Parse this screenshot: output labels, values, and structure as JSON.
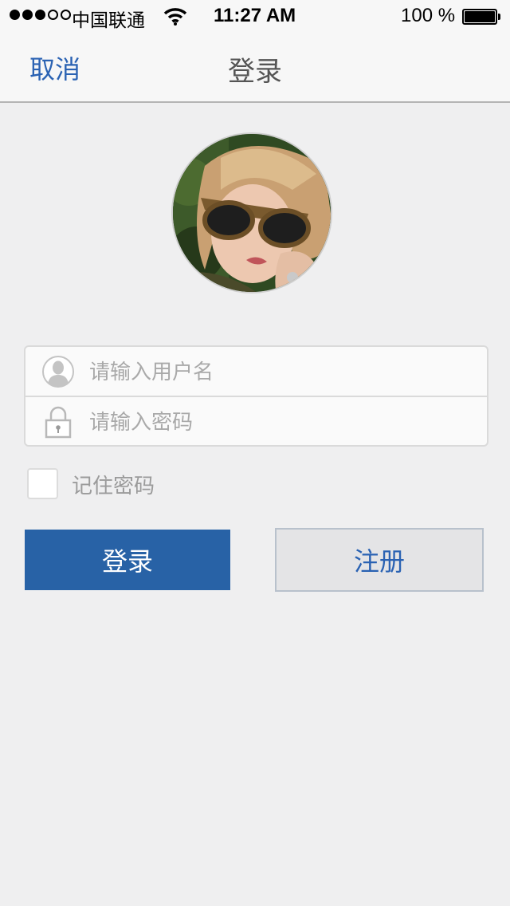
{
  "status_bar": {
    "carrier": "中国联通",
    "time": "11:27 AM",
    "battery": "100 %",
    "signal_bars_filled": 3,
    "signal_bars_total": 5
  },
  "nav": {
    "cancel_label": "取消",
    "title": "登录"
  },
  "avatar": {
    "icon": "user-avatar-photo"
  },
  "form": {
    "username": {
      "placeholder": "请输入用户名",
      "value": "",
      "icon": "user-icon"
    },
    "password": {
      "placeholder": "请输入密码",
      "value": "",
      "icon": "lock-icon"
    }
  },
  "remember": {
    "label": "记住密码",
    "checked": false
  },
  "buttons": {
    "login_label": "登录",
    "register_label": "注册"
  },
  "colors": {
    "accent": "#2a62b3",
    "login_bg": "#2862a6",
    "background": "#efeff0"
  }
}
